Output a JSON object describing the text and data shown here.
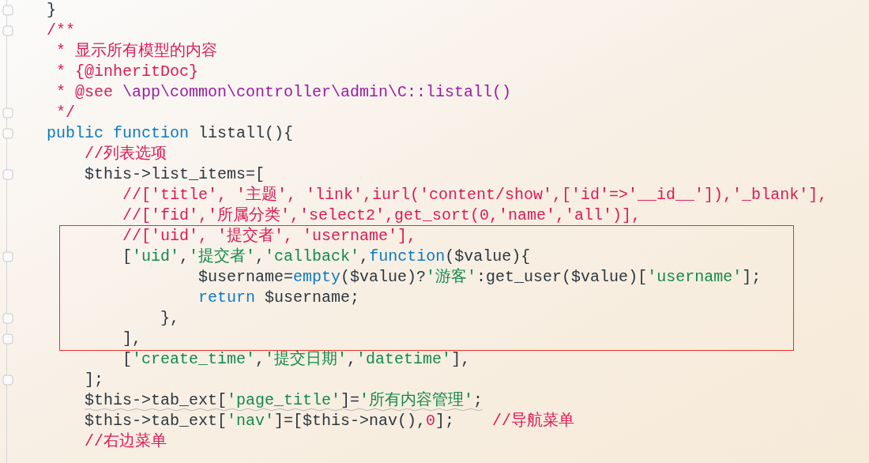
{
  "editor": {
    "sections": [
      {
        "kind": "normal",
        "lines": [
          {
            "fold": true,
            "warning": false,
            "tokens": [
              {
                "kind": "plain",
                "text": "}"
              }
            ]
          },
          {
            "fold": true,
            "warning": false,
            "tokens": [
              {
                "kind": "comment",
                "text": "/**"
              }
            ]
          },
          {
            "fold": false,
            "warning": false,
            "tokens": [
              {
                "kind": "comment",
                "text": " * 显示所有模型的内容"
              }
            ]
          },
          {
            "fold": false,
            "warning": false,
            "tokens": [
              {
                "kind": "comment",
                "text": " * {@inheritDoc}"
              }
            ]
          },
          {
            "fold": false,
            "warning": false,
            "tokens": [
              {
                "kind": "comment",
                "text": " * @see "
              },
              {
                "kind": "docpath",
                "text": "\\app\\common\\controller\\admin\\C::listall()"
              }
            ]
          },
          {
            "fold": true,
            "warning": false,
            "tokens": [
              {
                "kind": "comment",
                "text": " */"
              }
            ]
          },
          {
            "fold": true,
            "warning": false,
            "tokens": [
              {
                "kind": "keyword",
                "text": "public function"
              },
              {
                "kind": "plain",
                "text": " listall(){"
              }
            ]
          },
          {
            "fold": false,
            "warning": false,
            "tokens": [
              {
                "kind": "comment",
                "text": "    //列表选项"
              }
            ]
          },
          {
            "fold": true,
            "warning": false,
            "tokens": [
              {
                "kind": "plain",
                "text": "    $this->list_items=["
              }
            ]
          },
          {
            "fold": false,
            "warning": false,
            "tokens": [
              {
                "kind": "comment",
                "text": "        //['title', '主题', 'link',iurl('content/show',['id'=>'__id__']),'_blank'],"
              }
            ]
          },
          {
            "fold": false,
            "warning": false,
            "tokens": [
              {
                "kind": "comment",
                "text": "        //['fid','所属分类','select2',get_sort(0,'name','all')],"
              }
            ]
          }
        ]
      },
      {
        "kind": "boxed",
        "lines": [
          {
            "fold": false,
            "warning": false,
            "tokens": [
              {
                "kind": "comment",
                "text": "        //['uid', '提交者', 'username'],"
              }
            ]
          },
          {
            "fold": true,
            "warning": false,
            "tokens": [
              {
                "kind": "plain",
                "text": "        ["
              },
              {
                "kind": "string",
                "text": "'uid'"
              },
              {
                "kind": "plain",
                "text": ","
              },
              {
                "kind": "string",
                "text": "'提交者'"
              },
              {
                "kind": "plain",
                "text": ","
              },
              {
                "kind": "string",
                "text": "'callback'"
              },
              {
                "kind": "plain",
                "text": ","
              },
              {
                "kind": "keyword",
                "text": "function"
              },
              {
                "kind": "plain",
                "text": "($value){"
              }
            ]
          },
          {
            "fold": false,
            "warning": false,
            "tokens": [
              {
                "kind": "plain",
                "text": "                $username="
              },
              {
                "kind": "keyword",
                "text": "empty"
              },
              {
                "kind": "plain",
                "text": "($value)?"
              },
              {
                "kind": "string",
                "text": "'游客'"
              },
              {
                "kind": "plain",
                "text": ":get_user($value)["
              },
              {
                "kind": "string",
                "text": "'username'"
              },
              {
                "kind": "plain",
                "text": "];"
              }
            ]
          },
          {
            "fold": false,
            "warning": false,
            "tokens": [
              {
                "kind": "keyword",
                "text": "                return"
              },
              {
                "kind": "plain",
                "text": " $username;"
              }
            ]
          },
          {
            "fold": true,
            "warning": false,
            "tokens": [
              {
                "kind": "plain",
                "text": "            },"
              }
            ]
          },
          {
            "fold": true,
            "warning": false,
            "tokens": [
              {
                "kind": "plain",
                "text": "        ],"
              }
            ]
          }
        ]
      },
      {
        "kind": "normal",
        "lines": [
          {
            "fold": false,
            "warning": false,
            "tokens": [
              {
                "kind": "plain",
                "text": "        ["
              },
              {
                "kind": "string",
                "text": "'create_time'"
              },
              {
                "kind": "plain",
                "text": ","
              },
              {
                "kind": "string",
                "text": "'提交日期'"
              },
              {
                "kind": "plain",
                "text": ","
              },
              {
                "kind": "string",
                "text": "'datetime'"
              },
              {
                "kind": "plain",
                "text": "],"
              }
            ]
          },
          {
            "fold": true,
            "warning": false,
            "tokens": [
              {
                "kind": "plain",
                "text": "    ];"
              }
            ]
          },
          {
            "fold": false,
            "warning": true,
            "tokens": [
              {
                "kind": "plain",
                "text": "    $this->tab_ext["
              },
              {
                "kind": "string",
                "text": "'page_title'"
              },
              {
                "kind": "plain",
                "text": "]="
              },
              {
                "kind": "string",
                "text": "'所有内容管理'"
              },
              {
                "kind": "plain",
                "text": ";"
              }
            ]
          },
          {
            "fold": false,
            "warning": false,
            "tokens": [
              {
                "kind": "plain",
                "text": "    $this->tab_ext["
              },
              {
                "kind": "string",
                "text": "'nav'"
              },
              {
                "kind": "plain",
                "text": "]=[$this->nav(),"
              },
              {
                "kind": "number",
                "text": "0"
              },
              {
                "kind": "plain",
                "text": "];    "
              },
              {
                "kind": "comment",
                "text": "//导航菜单"
              }
            ]
          },
          {
            "fold": false,
            "warning": false,
            "tokens": [
              {
                "kind": "comment",
                "text": "    //右边菜单"
              }
            ]
          }
        ]
      }
    ]
  }
}
